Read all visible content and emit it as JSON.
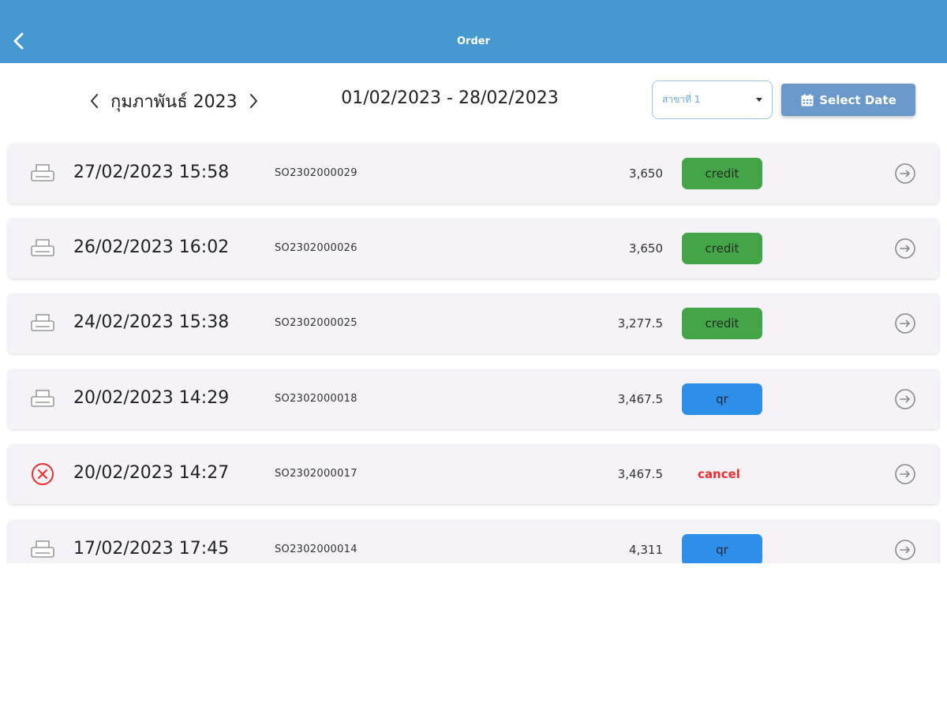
{
  "appbar": {
    "title": "Order",
    "back_icon": "chevron-left-icon",
    "color": "#4399cf"
  },
  "filters": {
    "month_label": "กุมภาพันธ์ 2023",
    "date_range": "01/02/2023 - 28/02/2023",
    "branch": "สาขาที่ 1",
    "select_date_label": "Select Date"
  },
  "colors": {
    "credit": "#44a548",
    "qr": "#2e8fe8",
    "cancel": "#ee2d2d"
  },
  "orders": [
    {
      "datetime": "27/02/2023 15:58",
      "order_id": "SO2302000029",
      "amount": "3,650",
      "status": "credit",
      "icon": "printer-icon"
    },
    {
      "datetime": "26/02/2023 16:02",
      "order_id": "SO2302000026",
      "amount": "3,650",
      "status": "credit",
      "icon": "printer-icon"
    },
    {
      "datetime": "24/02/2023 15:38",
      "order_id": "SO2302000025",
      "amount": "3,277.5",
      "status": "credit",
      "icon": "printer-icon"
    },
    {
      "datetime": "20/02/2023 14:29",
      "order_id": "SO2302000018",
      "amount": "3,467.5",
      "status": "qr",
      "icon": "printer-icon"
    },
    {
      "datetime": "20/02/2023 14:27",
      "order_id": "SO2302000017",
      "amount": "3,467.5",
      "status": "cancel",
      "icon": "cancel-circle-icon"
    },
    {
      "datetime": "17/02/2023 17:45",
      "order_id": "SO2302000014",
      "amount": "4,311",
      "status": "qr",
      "icon": "printer-icon"
    }
  ]
}
